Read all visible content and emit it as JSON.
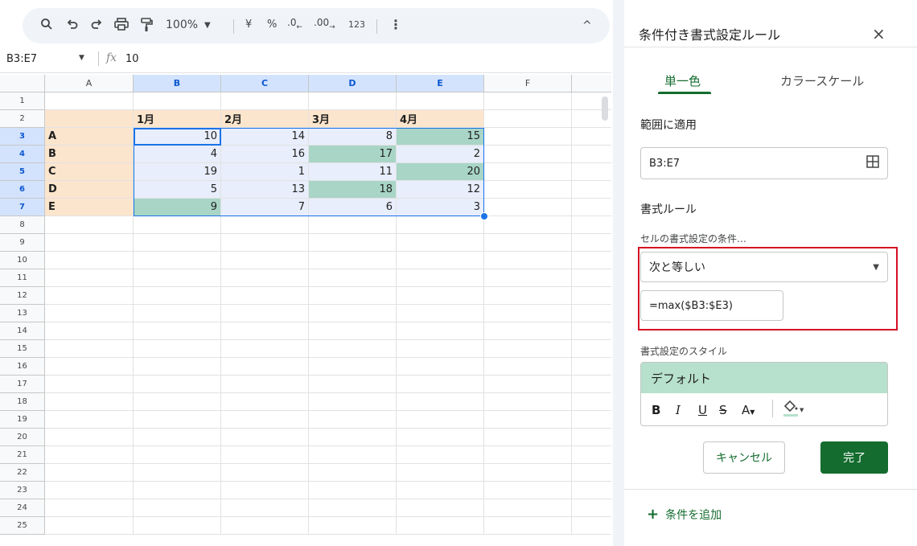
{
  "toolbar": {
    "zoom": "100%",
    "currency": "¥",
    "percent": "%",
    "decrease_decimal": ".0",
    "increase_decimal": ".00",
    "number_format": "123",
    "more": "⋮",
    "collapse": "^"
  },
  "formula_bar": {
    "name_box": "B3:E7",
    "fx": "fx",
    "value": "10"
  },
  "sheet": {
    "columns": [
      "A",
      "B",
      "C",
      "D",
      "E",
      "F"
    ],
    "rows": [
      "1",
      "2",
      "3",
      "4",
      "5",
      "6",
      "7",
      "8",
      "9",
      "10",
      "11",
      "12",
      "13",
      "14",
      "15",
      "16",
      "17",
      "18",
      "19",
      "20",
      "21",
      "22",
      "23",
      "24",
      "25"
    ],
    "headers": [
      "1月",
      "2月",
      "3月",
      "4月"
    ],
    "row_labels": [
      "A",
      "B",
      "C",
      "D",
      "E"
    ],
    "values": [
      [
        10,
        14,
        8,
        15
      ],
      [
        4,
        16,
        17,
        2
      ],
      [
        19,
        1,
        11,
        20
      ],
      [
        5,
        13,
        18,
        12
      ],
      [
        9,
        7,
        6,
        3
      ]
    ],
    "highlighted": [
      [
        0,
        3
      ],
      [
        1,
        2
      ],
      [
        2,
        3
      ],
      [
        3,
        2
      ],
      [
        4,
        0
      ]
    ],
    "colors": {
      "label_fill": "#fce5cd",
      "range_fill": "#e8eefb",
      "highlight_fill": "#a8d5c6",
      "selection": "#1a73e8"
    }
  },
  "panel": {
    "title": "条件付き書式設定ルール",
    "close": "×",
    "tab_single": "単一色",
    "tab_scale": "カラースケール",
    "apply_label": "範囲に適用",
    "range": "B3:E7",
    "rules_label": "書式ルール",
    "condition_label": "セルの書式設定の条件…",
    "condition": "次と等しい",
    "value": "=max($B3:$E3)",
    "style_label": "書式設定のスタイル",
    "style_preview": "デフォルト",
    "cancel": "キャンセル",
    "done": "完了",
    "add_rule": "条件を追加",
    "add_icon": "+"
  }
}
